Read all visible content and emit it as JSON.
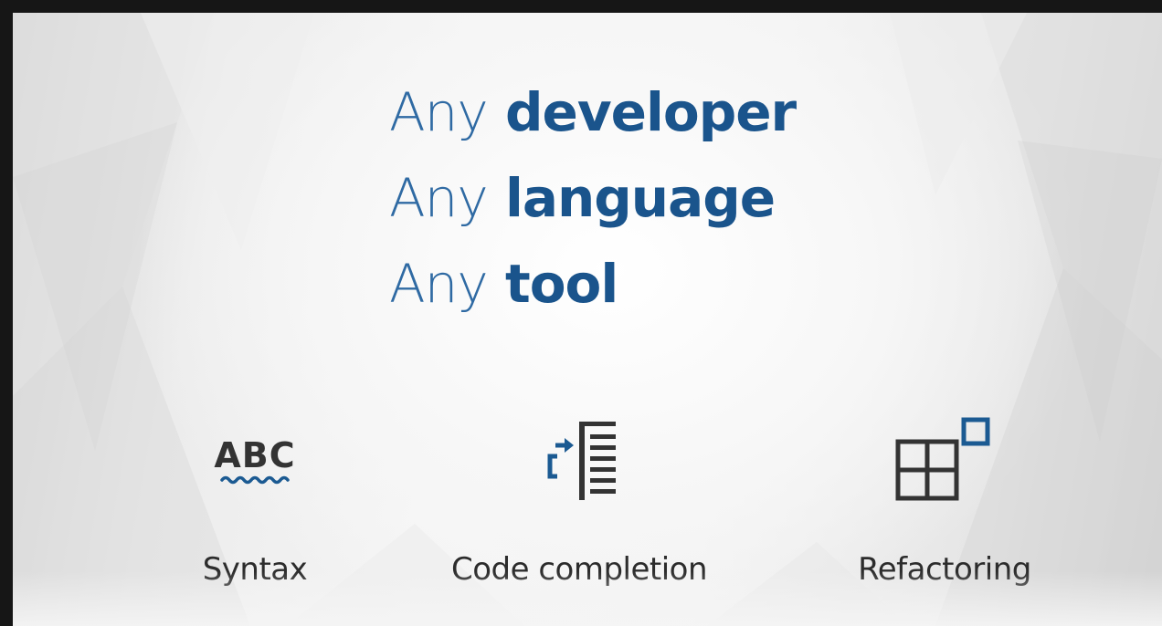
{
  "headline": {
    "lines": [
      {
        "prefix": "Any",
        "keyword": "developer"
      },
      {
        "prefix": "Any",
        "keyword": "language"
      },
      {
        "prefix": "Any",
        "keyword": "tool"
      }
    ]
  },
  "features": [
    {
      "icon": "abc-spellcheck-icon",
      "label": "Syntax"
    },
    {
      "icon": "code-completion-icon",
      "label": "Code completion"
    },
    {
      "icon": "refactoring-icon",
      "label": "Refactoring"
    }
  ],
  "colors": {
    "accent": "#1a548c",
    "icon_blue": "#1b5a92",
    "icon_dark": "#333333",
    "label": "#2c2c2c"
  }
}
